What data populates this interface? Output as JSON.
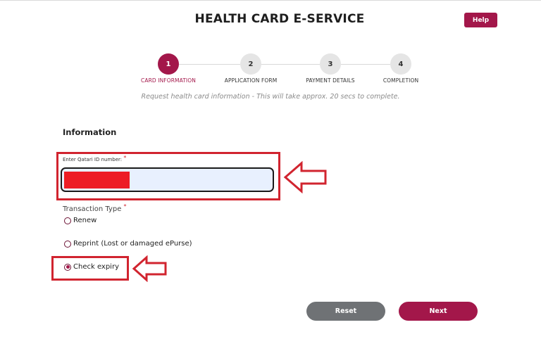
{
  "header": {
    "title": "HEALTH CARD E-SERVICE",
    "help_label": "Help"
  },
  "stepper": {
    "steps": [
      {
        "number": "1",
        "label": "CARD INFORMATION",
        "state": "active"
      },
      {
        "number": "2",
        "label": "APPLICATION FORM",
        "state": "inactive"
      },
      {
        "number": "3",
        "label": "PAYMENT DETAILS",
        "state": "inactive"
      },
      {
        "number": "4",
        "label": "COMPLETION",
        "state": "inactive"
      }
    ],
    "hint": "Request health card information - This will take approx. 20 secs to complete."
  },
  "form": {
    "section_title": "Information",
    "id_label": "Enter Qatari ID number:",
    "required_mark": "*",
    "id_value": "",
    "transaction_label": "Transaction Type",
    "options": [
      {
        "label": "Renew",
        "selected": false
      },
      {
        "label": "Reprint (Lost or damaged ePurse)",
        "selected": false
      },
      {
        "label": "Check expiry",
        "selected": true
      }
    ]
  },
  "actions": {
    "reset_label": "Reset",
    "next_label": "Next"
  },
  "colors": {
    "brand": "#a3174a",
    "annotation": "#d1242f",
    "redaction": "#ed1c24",
    "reset": "#6f7275"
  }
}
